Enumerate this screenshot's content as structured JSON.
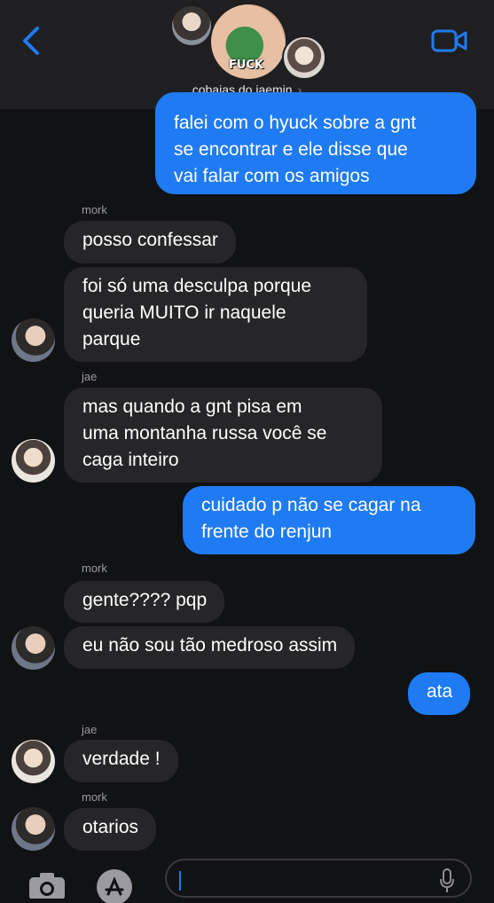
{
  "header": {
    "group_name": "cobaias do jaemin",
    "chevron": "›",
    "avatar_caption": "FUCK",
    "back_icon": "chevron-left-icon",
    "video_icon": "video-camera-icon"
  },
  "messages": [
    {
      "side": "out",
      "text_lines": [
        "falei com o hyuck sobre a gnt",
        "se encontrar e ele disse que",
        "vai falar com os amigos"
      ]
    },
    {
      "side": "in",
      "sender": "mork",
      "text": "posso confessar"
    },
    {
      "side": "in",
      "text_lines": [
        "foi só uma desculpa porque",
        "queria MUITO ir naquele",
        "parque"
      ]
    },
    {
      "side": "in",
      "sender": "jae",
      "text_lines": [
        "mas quando a gnt pisa em",
        "uma montanha russa você se",
        "caga inteiro"
      ]
    },
    {
      "side": "out",
      "text_lines": [
        "cuidado p não se cagar na",
        "frente do renjun"
      ]
    },
    {
      "side": "in",
      "sender": "mork",
      "text": "gente???? pqp"
    },
    {
      "side": "in",
      "text": "eu não sou tão medroso assim"
    },
    {
      "side": "out",
      "text": "ata"
    },
    {
      "side": "in",
      "sender": "jae",
      "text": "verdade !"
    },
    {
      "side": "in",
      "sender": "mork",
      "text": "otarios"
    }
  ],
  "composer": {
    "camera_icon": "camera-icon",
    "appstore_icon": "app-store-icon",
    "mic_icon": "microphone-icon"
  },
  "colors": {
    "outgoing_bubble": "#1f7bf3",
    "incoming_bubble": "#262628",
    "background": "#111214",
    "accent": "#1f7bf3"
  }
}
